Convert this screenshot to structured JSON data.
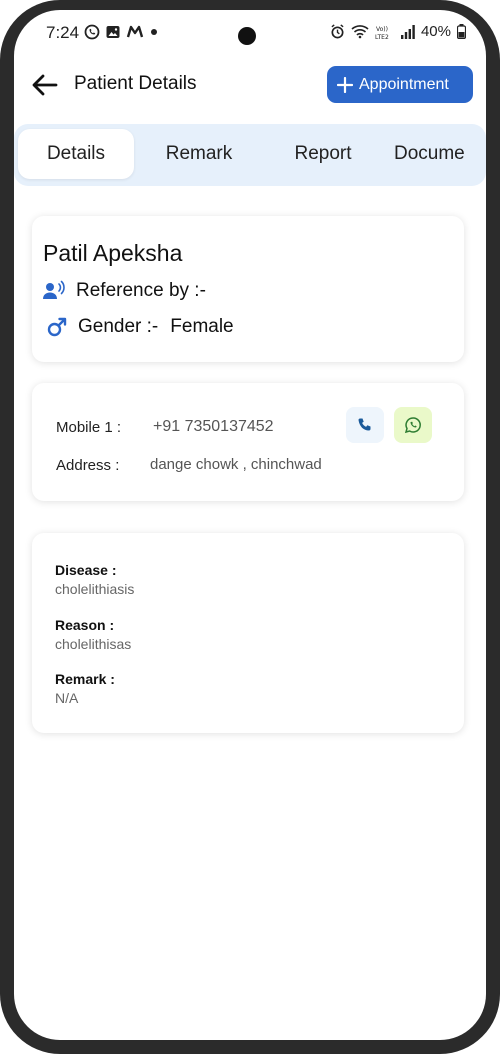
{
  "status": {
    "time": "7:24",
    "battery": "40%",
    "icons": [
      "whatsapp-icon",
      "gallery-icon",
      "m-app-icon",
      "dot-icon",
      "alarm-icon",
      "wifi-icon",
      "signal-icon",
      "battery-icon"
    ]
  },
  "header": {
    "title": "Patient Details",
    "appointment_label": "Appointment"
  },
  "tabs": [
    {
      "label": "Details"
    },
    {
      "label": "Remark"
    },
    {
      "label": "Report"
    },
    {
      "label": "Docume"
    }
  ],
  "patient": {
    "name": "Patil Apeksha",
    "reference": "Reference by :-",
    "gender_label": "Gender :-",
    "gender_value": "Female"
  },
  "contact": {
    "mobile_label": "Mobile 1 :",
    "mobile_value": "+91 7350137452",
    "address_label": "Address :",
    "address_value": "dange chowk , chinchwad"
  },
  "medical": {
    "disease_label": "Disease :",
    "disease_value": "cholelithiasis",
    "reason_label": "Reason :",
    "reason_value": "cholelithisas",
    "remark_label": "Remark :",
    "remark_value": "N/A"
  },
  "colors": {
    "primary": "#2b66c9",
    "tab_bg": "#e6f0fb",
    "call_bg": "#eef5fc",
    "whatsapp_bg": "#eaf9c9"
  }
}
